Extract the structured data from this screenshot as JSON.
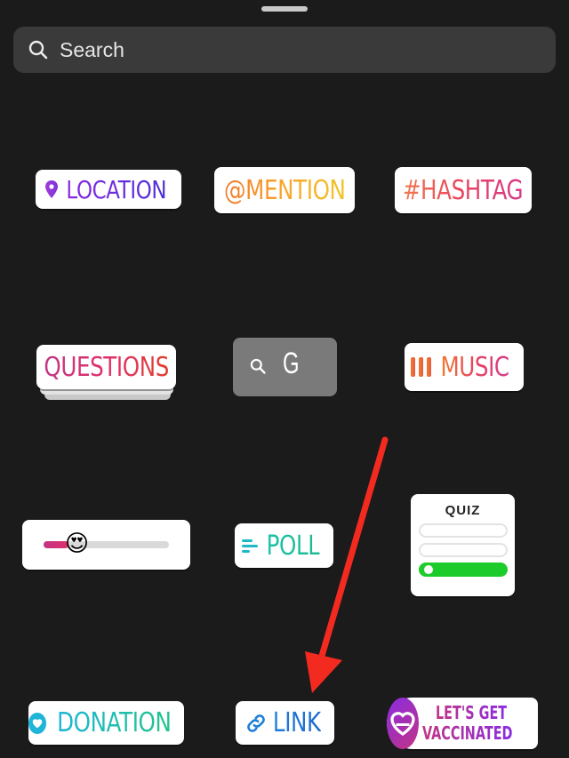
{
  "search": {
    "placeholder": "Search",
    "value": ""
  },
  "stickers": {
    "location": "LOCATION",
    "mention": "@MENTION",
    "hashtag": "#HASHTAG",
    "questions": "QUESTIONS",
    "gif": "G",
    "music": "MUSIC",
    "poll": "POLL",
    "quiz": "QUIZ",
    "donation": "DONATION",
    "link": "LINK",
    "vaccinated_line1": "LET'S GET",
    "vaccinated_line2": "VACCINATED"
  },
  "slider": {
    "level": 0.2,
    "emoji": "😍"
  },
  "colors": {
    "background": "#1b1b1b",
    "search_bg": "#3a3a3a",
    "arrow": "#f32a1f"
  }
}
